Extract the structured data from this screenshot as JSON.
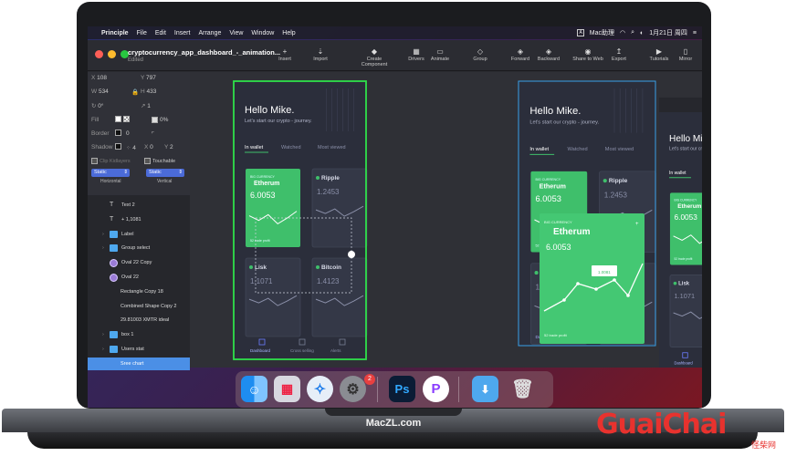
{
  "menubar": {
    "apple": "",
    "app": "Principle",
    "items": [
      "File",
      "Edit",
      "Insert",
      "Arrange",
      "View",
      "Window",
      "Help"
    ],
    "right_app": "Mac助理",
    "date": "1月21日 周四",
    "menu_icon": "≡"
  },
  "window": {
    "title": "cryptocurrency_app_dashboard_-_animation...",
    "subtitle": "Edited",
    "toolbar": [
      {
        "label": "Insert",
        "icon": "+"
      },
      {
        "label": "Import",
        "icon": "⇣"
      },
      {
        "label": "Create Component",
        "icon": "◆"
      },
      {
        "label": "Drivers",
        "icon": "▦"
      },
      {
        "label": "Animate",
        "icon": "▭"
      },
      {
        "label": "Group",
        "icon": "◇"
      },
      {
        "label": "Forward",
        "icon": "◈"
      },
      {
        "label": "Backward",
        "icon": "◈"
      },
      {
        "label": "Share to Web",
        "icon": "◉"
      },
      {
        "label": "Export",
        "icon": "↥"
      },
      {
        "label": "Tutorials",
        "icon": "▶"
      },
      {
        "label": "Mirror",
        "icon": "▯"
      }
    ]
  },
  "inspector": {
    "x": "108",
    "y": "797",
    "w": "534",
    "h": "433",
    "rotation": "0°",
    "scale": "1",
    "fill_label": "Fill",
    "fill_opacity": "0%",
    "border_label": "Border",
    "border_value": "0",
    "shadow_label": "Shadow",
    "shadow_x": "4",
    "shadow_x2": "0",
    "shadow_y": "2",
    "clip": "Clip Kidlayers",
    "touchable": "Touchable",
    "horizontal_sel": "Static",
    "vertical_sel": "Static",
    "horizontal_label": "Horizontal",
    "vertical_label": "Vertical"
  },
  "layers": [
    {
      "name": "Text 2",
      "icon": "text",
      "indent": 1
    },
    {
      "name": "+ 1,1081",
      "icon": "text",
      "indent": 1
    },
    {
      "name": "Label",
      "icon": "folder",
      "indent": 0
    },
    {
      "name": "Group select",
      "icon": "folder",
      "indent": 0
    },
    {
      "name": "Oval 22 Copy",
      "icon": "oval",
      "indent": 0
    },
    {
      "name": "Oval 22",
      "icon": "oval",
      "indent": 0
    },
    {
      "name": "Rectangle Copy 18",
      "icon": "none",
      "indent": 0
    },
    {
      "name": "Combined Shape Copy 2",
      "icon": "none",
      "indent": 0
    },
    {
      "name": "29.81003 XMTR ideal",
      "icon": "none",
      "indent": 0
    },
    {
      "name": "box 1",
      "icon": "folder",
      "indent": 0
    },
    {
      "name": "Users stat",
      "icon": "folder",
      "indent": 0
    },
    {
      "name": "Sree chart",
      "icon": "none",
      "indent": 0,
      "active": true
    }
  ],
  "app": {
    "greeting": "Hello Mike.",
    "subtitle": "Let's start our crypto - journey.",
    "tabs": [
      "In wallet",
      "Watched",
      "Most viewed"
    ],
    "cards": [
      {
        "name": "Etherum",
        "value": "6.0053",
        "tag": "BIG CURRENCY"
      },
      {
        "name": "Ripple",
        "value": "1.2453"
      },
      {
        "name": "Lisk",
        "value": "1.1071"
      },
      {
        "name": "Bitcoin",
        "value": "1.4123"
      }
    ],
    "nav": [
      "Dashboard",
      "Cross selling",
      "Alerts"
    ],
    "tooltip": "1.0081",
    "small_label": "52 trade profit"
  },
  "dock": {
    "ps": "Ps",
    "badge": "2"
  },
  "laptop_brand": "MacZL.com",
  "watermark": {
    "en": "GuaiChai",
    "cn": "怪柴网"
  }
}
